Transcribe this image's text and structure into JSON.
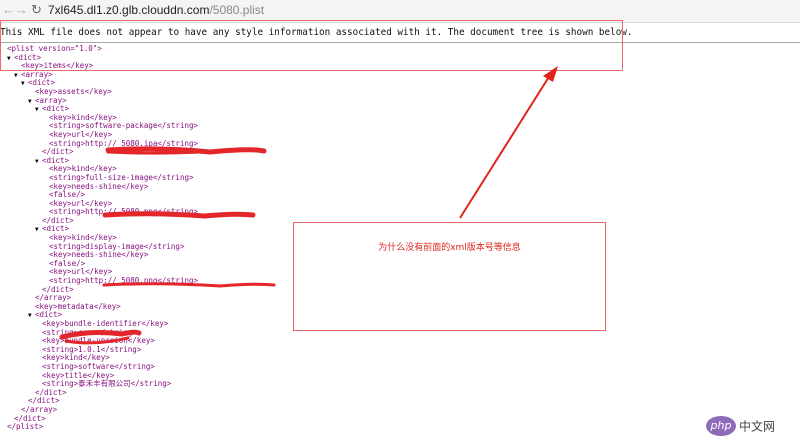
{
  "browser": {
    "url_host": "7xl645.dl1.z0.glb.clouddn.com",
    "url_path": "/5080.plist"
  },
  "notice": "This XML file does not appear to have any style information associated with it. The document tree is shown below.",
  "xml_lines": [
    {
      "indent": 0,
      "toggle": false,
      "text": "<plist version=\"1.0\">"
    },
    {
      "indent": 1,
      "toggle": true,
      "text": "<dict>"
    },
    {
      "indent": 2,
      "toggle": false,
      "text": "<key>items</key>"
    },
    {
      "indent": 2,
      "toggle": true,
      "text": "<array>"
    },
    {
      "indent": 3,
      "toggle": true,
      "text": "<dict>"
    },
    {
      "indent": 4,
      "toggle": false,
      "text": "<key>assets</key>"
    },
    {
      "indent": 4,
      "toggle": true,
      "text": "<array>"
    },
    {
      "indent": 5,
      "toggle": true,
      "text": "<dict>"
    },
    {
      "indent": 6,
      "toggle": false,
      "text": "<key>kind</key>"
    },
    {
      "indent": 6,
      "toggle": false,
      "text": "<string>software-package</string>"
    },
    {
      "indent": 6,
      "toggle": false,
      "text": "<key>url</key>"
    },
    {
      "indent": 6,
      "toggle": false,
      "text": "<string>http://                                  5080.ipa</string>"
    },
    {
      "indent": 5,
      "toggle": false,
      "text": "</dict>"
    },
    {
      "indent": 5,
      "toggle": true,
      "text": "<dict>"
    },
    {
      "indent": 6,
      "toggle": false,
      "text": "<key>kind</key>"
    },
    {
      "indent": 6,
      "toggle": false,
      "text": "<string>full-size-image</string>"
    },
    {
      "indent": 6,
      "toggle": false,
      "text": "<key>needs-shine</key>"
    },
    {
      "indent": 6,
      "toggle": false,
      "text": "<false/>"
    },
    {
      "indent": 6,
      "toggle": false,
      "text": "<key>url</key>"
    },
    {
      "indent": 6,
      "toggle": false,
      "text": "<string>http://                                  5080.png</string>"
    },
    {
      "indent": 5,
      "toggle": false,
      "text": "</dict>"
    },
    {
      "indent": 5,
      "toggle": true,
      "text": "<dict>"
    },
    {
      "indent": 6,
      "toggle": false,
      "text": "<key>kind</key>"
    },
    {
      "indent": 6,
      "toggle": false,
      "text": "<string>display-image</string>"
    },
    {
      "indent": 6,
      "toggle": false,
      "text": "<key>needs-shine</key>"
    },
    {
      "indent": 6,
      "toggle": false,
      "text": "<false/>"
    },
    {
      "indent": 6,
      "toggle": false,
      "text": "<key>url</key>"
    },
    {
      "indent": 6,
      "toggle": false,
      "text": "<string>http://                                  5080.png</string>"
    },
    {
      "indent": 5,
      "toggle": false,
      "text": "</dict>"
    },
    {
      "indent": 4,
      "toggle": false,
      "text": "</array>"
    },
    {
      "indent": 4,
      "toggle": false,
      "text": "<key>metadata</key>"
    },
    {
      "indent": 4,
      "toggle": true,
      "text": "<dict>"
    },
    {
      "indent": 5,
      "toggle": false,
      "text": "<key>bundle-identifier</key>"
    },
    {
      "indent": 5,
      "toggle": false,
      "text": "<string>com               </string>"
    },
    {
      "indent": 5,
      "toggle": false,
      "text": "<key>bundle-version</key>"
    },
    {
      "indent": 5,
      "toggle": false,
      "text": "<string>1.0.1</string>"
    },
    {
      "indent": 5,
      "toggle": false,
      "text": "<key>kind</key>"
    },
    {
      "indent": 5,
      "toggle": false,
      "text": "<string>software</string>"
    },
    {
      "indent": 5,
      "toggle": false,
      "text": "<key>title</key>"
    },
    {
      "indent": 5,
      "toggle": false,
      "text": "<string>泰禾丰有限公司</string>"
    },
    {
      "indent": 4,
      "toggle": false,
      "text": "</dict>"
    },
    {
      "indent": 3,
      "toggle": false,
      "text": "</dict>"
    },
    {
      "indent": 2,
      "toggle": false,
      "text": "</array>"
    },
    {
      "indent": 1,
      "toggle": false,
      "text": "</dict>"
    },
    {
      "indent": 0,
      "toggle": false,
      "text": "</plist>"
    }
  ],
  "annotation": {
    "note": "为什么没有前面的xml版本号等信息",
    "color": "#e0251c"
  },
  "watermark": {
    "logo": "php",
    "text": "中文网"
  }
}
